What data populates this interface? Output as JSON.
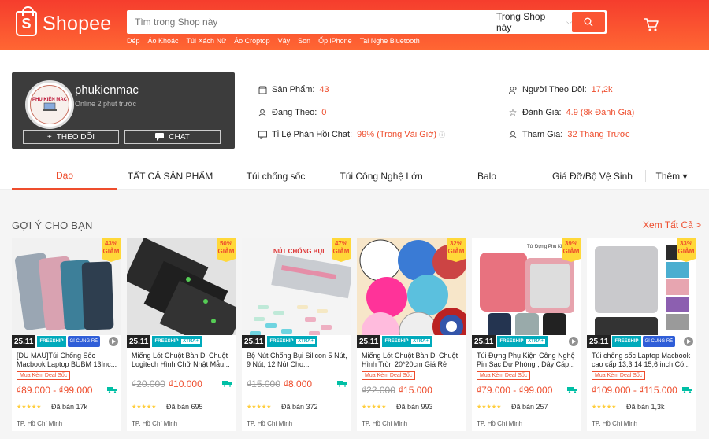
{
  "header": {
    "logo_text": "Shopee",
    "search_placeholder": "Tìm trong Shop này",
    "scope_label": "Trong Shop này",
    "keywords": [
      "Dép",
      "Áo Khoác",
      "Túi Xách Nữ",
      "Áo Croptop",
      "Váy",
      "Son",
      "Ốp iPhone",
      "Tai Nghe Bluetooth"
    ]
  },
  "shop": {
    "name": "phukienmac",
    "online": "Online 2 phút trước",
    "avatar_text": "PHỤ KIỆN MAC",
    "follow_label": "THEO DÕI",
    "chat_label": "CHAT"
  },
  "stats": {
    "products_label": "Sản Phẩm:",
    "products_value": "43",
    "following_label": "Đang Theo:",
    "following_value": "0",
    "chat_rate_label": "Tỉ Lệ Phản Hồi Chat:",
    "chat_rate_value": "99% (Trong Vài Giờ)",
    "followers_label": "Người Theo Dõi:",
    "followers_value": "17,2k",
    "rating_label": "Đánh Giá:",
    "rating_value": "4.9 (8k Đánh Giá)",
    "joined_label": "Tham Gia:",
    "joined_value": "32 Tháng Trước"
  },
  "tabs": [
    "Dạo",
    "TẤT CẢ SẢN PHẨM",
    "Túi chống sốc",
    "Túi Công Nghệ Lớn",
    "Balo",
    "Giá Đỡ/Bộ Vệ Sinh",
    "Thêm ▾"
  ],
  "recommend": {
    "title": "GỢI Ý CHO BẠN",
    "see_all": "Xem Tất Cả >"
  },
  "banner": {
    "date": "25.11",
    "freeship": "FREESHIP",
    "extra": "XTRA+",
    "cheap": "GÌ CŨNG RẺ"
  },
  "products": [
    {
      "discount": "43%",
      "discount_word": "GIẢM",
      "name": "[DU MAU]Túi Chống Sốc Macbook Laptop BUBM 13Inc...",
      "deal": "Mua Kèm Deal Sốc",
      "old_price": "",
      "price": "₫89.000 - ₫99.000",
      "sold": "Đã bán 17k",
      "location": "TP. Hồ Chí Minh"
    },
    {
      "discount": "50%",
      "discount_word": "GIẢM",
      "name": "Miếng Lót Chuột Bàn Di Chuột Logitech Hình Chữ Nhật Mẫu...",
      "deal": "",
      "old_price": "₫20.000",
      "price": "₫10.000",
      "sold": "Đã bán 695",
      "location": "TP. Hồ Chí Minh"
    },
    {
      "discount": "47%",
      "discount_word": "GIẢM",
      "name": "Bộ Nút Chống Bụi Silicon 5 Nút, 9 Nút, 12 Nút Cho...",
      "deal": "",
      "old_price": "₫15.000",
      "price": "₫8.000",
      "sold": "Đã bán 372",
      "location": "TP. Hồ Chí Minh"
    },
    {
      "discount": "32%",
      "discount_word": "GIẢM",
      "name": "Miếng Lót Chuột Bàn Di Chuột Hình Tròn 20*20cm Giá Rẻ",
      "deal": "Mua Kèm Deal Sốc",
      "old_price": "₫22.000",
      "price": "₫15.000",
      "sold": "Đã bán 993",
      "location": "TP. Hồ Chí Minh"
    },
    {
      "discount": "39%",
      "discount_word": "GIẢM",
      "name": "Túi Đựng Phụ Kiện Công Nghệ Pin Sạc Dự Phòng , Dây Cáp...",
      "deal": "Mua Kèm Deal Sốc",
      "old_price": "",
      "price": "₫79.000 - ₫99.000",
      "sold": "Đã bán 257",
      "location": "TP. Hồ Chí Minh"
    },
    {
      "discount": "33%",
      "discount_word": "GIẢM",
      "name": "Túi chống sốc Laptop Macbook cao cấp 13,3 14 15,6 inch Có...",
      "deal": "Mua Kèm Deal Sốc",
      "old_price": "",
      "price": "₫109.000 - ₫115.000",
      "sold": "Đã bán 1,3k",
      "location": "TP. Hồ Chí Minh"
    }
  ]
}
